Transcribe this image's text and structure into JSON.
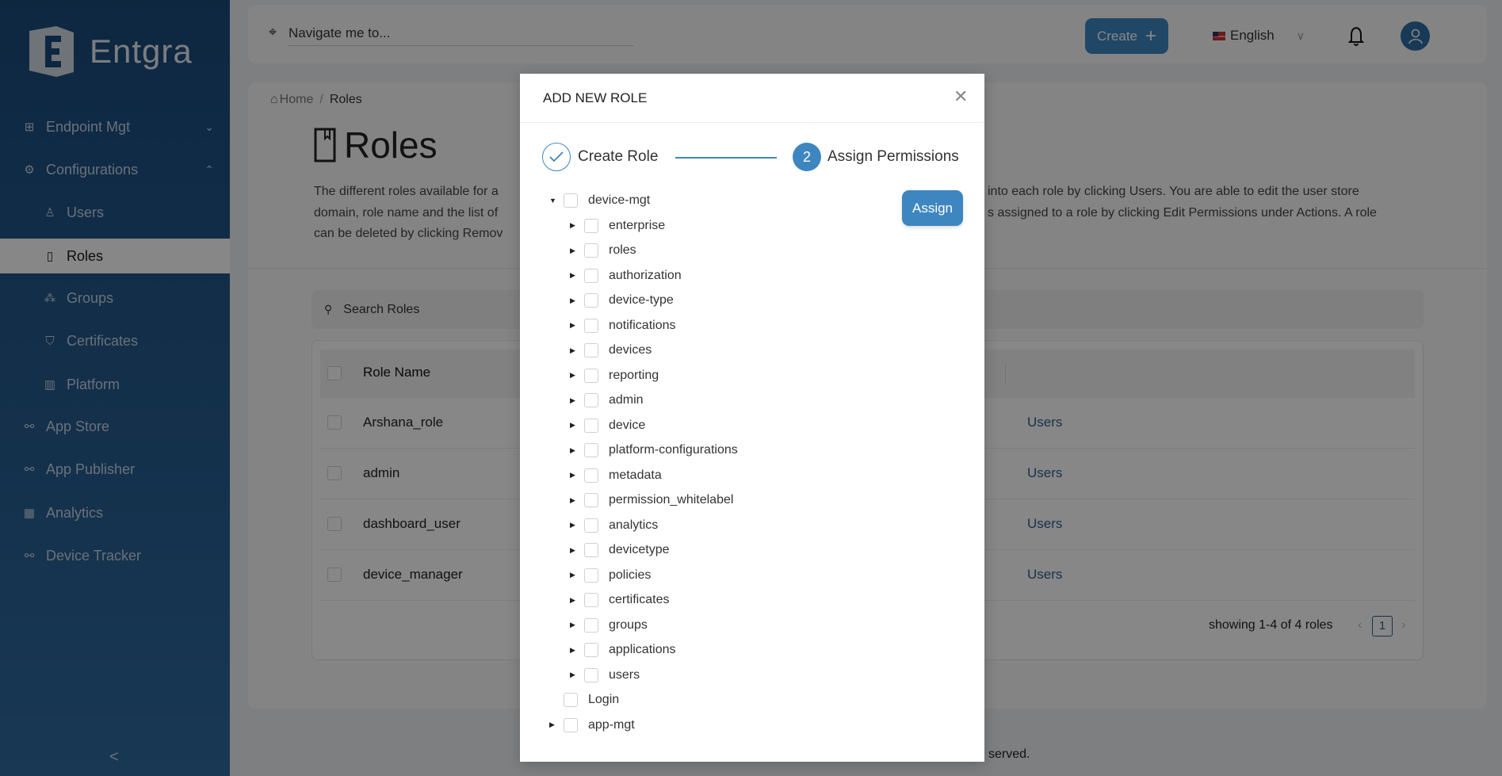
{
  "brand": {
    "name": "Entgra"
  },
  "colors": {
    "accent": "#3e86c0",
    "sidebar": "#1b4b7c",
    "link": "#2e5f8f"
  },
  "sidebar": {
    "items": [
      {
        "label": "Endpoint Mgt",
        "icon": "grid-icon",
        "expanded": false
      },
      {
        "label": "Configurations",
        "icon": "gear-icon",
        "expanded": true
      },
      {
        "label": "Users",
        "icon": "user-icon",
        "sub": true
      },
      {
        "label": "Roles",
        "icon": "book-icon",
        "sub": true,
        "active": true
      },
      {
        "label": "Groups",
        "icon": "network-icon",
        "sub": true
      },
      {
        "label": "Certificates",
        "icon": "shield-check-icon",
        "sub": true
      },
      {
        "label": "Platform",
        "icon": "sliders-icon",
        "sub": true
      },
      {
        "label": "App Store",
        "icon": "link-icon"
      },
      {
        "label": "App Publisher",
        "icon": "link-icon"
      },
      {
        "label": "Analytics",
        "icon": "building-icon"
      },
      {
        "label": "Device Tracker",
        "icon": "link-icon"
      }
    ],
    "collapse": "<"
  },
  "topbar": {
    "navigate_placeholder": "Navigate me to...",
    "create_label": "Create",
    "language": "English"
  },
  "breadcrumb": {
    "home": "Home",
    "sep": "/",
    "current": "Roles"
  },
  "page": {
    "title": "Roles",
    "desc_left": [
      "The different roles available for a",
      "domain, role name and the list of",
      "can be deleted by clicking Remov"
    ],
    "desc_right": [
      "into each role by clicking Users. You are able to edit the user store",
      "s assigned to a role by clicking Edit Permissions under Actions. A role"
    ]
  },
  "search": {
    "placeholder": "Search Roles"
  },
  "table": {
    "header": "Role Name",
    "rows": [
      {
        "name": "Arshana_role",
        "action": "Users"
      },
      {
        "name": "admin",
        "action": "Users"
      },
      {
        "name": "dashboard_user",
        "action": "Users"
      },
      {
        "name": "device_manager",
        "action": "Users"
      }
    ],
    "pagination": {
      "summary": "showing 1-4 of 4 roles",
      "current_page": "1"
    }
  },
  "footer": {
    "visible_text": "served."
  },
  "modal": {
    "title": "ADD NEW ROLE",
    "steps": [
      {
        "label": "Create Role",
        "status": "done"
      },
      {
        "number": "2",
        "label": "Assign Permissions",
        "status": "current"
      }
    ],
    "assign_label": "Assign",
    "tree": [
      {
        "label": "device-mgt",
        "level": 0,
        "caret": "down"
      },
      {
        "label": "enterprise",
        "level": 1,
        "caret": "right"
      },
      {
        "label": "roles",
        "level": 1,
        "caret": "right"
      },
      {
        "label": "authorization",
        "level": 1,
        "caret": "right"
      },
      {
        "label": "device-type",
        "level": 1,
        "caret": "right"
      },
      {
        "label": "notifications",
        "level": 1,
        "caret": "right"
      },
      {
        "label": "devices",
        "level": 1,
        "caret": "right"
      },
      {
        "label": "reporting",
        "level": 1,
        "caret": "right"
      },
      {
        "label": "admin",
        "level": 1,
        "caret": "right"
      },
      {
        "label": "device",
        "level": 1,
        "caret": "right"
      },
      {
        "label": "platform-configurations",
        "level": 1,
        "caret": "right"
      },
      {
        "label": "metadata",
        "level": 1,
        "caret": "right"
      },
      {
        "label": "permission_whitelabel",
        "level": 1,
        "caret": "right"
      },
      {
        "label": "analytics",
        "level": 1,
        "caret": "right"
      },
      {
        "label": "devicetype",
        "level": 1,
        "caret": "right"
      },
      {
        "label": "policies",
        "level": 1,
        "caret": "right"
      },
      {
        "label": "certificates",
        "level": 1,
        "caret": "right"
      },
      {
        "label": "groups",
        "level": 1,
        "caret": "right"
      },
      {
        "label": "applications",
        "level": 1,
        "caret": "right"
      },
      {
        "label": "users",
        "level": 1,
        "caret": "right"
      },
      {
        "label": "Login",
        "level": 0,
        "caret": "none"
      },
      {
        "label": "app-mgt",
        "level": 0,
        "caret": "right"
      }
    ]
  }
}
